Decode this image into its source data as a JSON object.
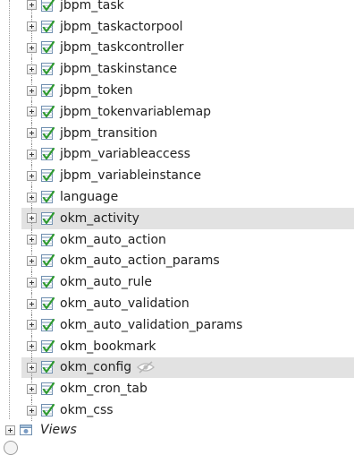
{
  "tables": [
    {
      "name": "jbpm_task"
    },
    {
      "name": "jbpm_taskactorpool"
    },
    {
      "name": "jbpm_taskcontroller"
    },
    {
      "name": "jbpm_taskinstance"
    },
    {
      "name": "jbpm_token"
    },
    {
      "name": "jbpm_tokenvariablemap"
    },
    {
      "name": "jbpm_transition"
    },
    {
      "name": "jbpm_variableaccess"
    },
    {
      "name": "jbpm_variableinstance"
    },
    {
      "name": "language"
    },
    {
      "name": "okm_activity",
      "highlighted": true
    },
    {
      "name": "okm_auto_action"
    },
    {
      "name": "okm_auto_action_params"
    },
    {
      "name": "okm_auto_rule"
    },
    {
      "name": "okm_auto_validation"
    },
    {
      "name": "okm_auto_validation_params"
    },
    {
      "name": "okm_bookmark"
    },
    {
      "name": "okm_config",
      "highlighted": true,
      "show_visibility_icon": true
    },
    {
      "name": "okm_cron_tab"
    },
    {
      "name": "okm_css"
    }
  ],
  "views": {
    "label": "Views"
  },
  "colors": {
    "highlight": "#e2e2e2",
    "table_icon_border": "#6f8fb0",
    "table_icon_check": "#2f9a2f"
  },
  "icons": {
    "expand": "plus-expander-icon",
    "table": "table-icon",
    "hidden": "eye-slash-icon",
    "views_folder": "views-folder-icon"
  }
}
